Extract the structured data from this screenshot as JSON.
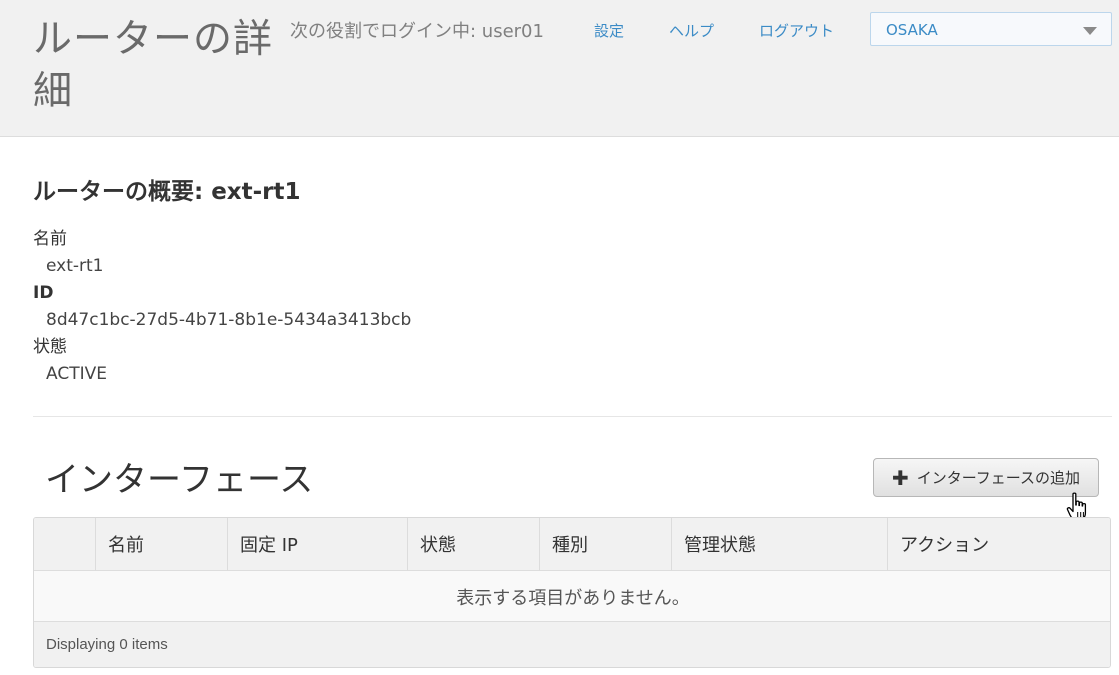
{
  "header": {
    "title": "ルーターの詳細",
    "login_info": "次の役割でログイン中: user01",
    "nav": {
      "settings": "設定",
      "help": "ヘルプ",
      "logout": "ログアウト"
    },
    "region_select": {
      "selected": "OSAKA"
    }
  },
  "overview": {
    "title": "ルーターの概要: ext-rt1",
    "fields": [
      {
        "label": "名前",
        "value": "ext-rt1"
      },
      {
        "label": "ID",
        "value": "8d47c1bc-27d5-4b71-8b1e-5434a3413bcb"
      },
      {
        "label": "状態",
        "value": "ACTIVE"
      }
    ]
  },
  "interfaces": {
    "title": "インターフェース",
    "add_button_label": "インターフェースの追加",
    "table": {
      "columns": [
        "",
        "名前",
        "固定 IP",
        "状態",
        "種別",
        "管理状態",
        "アクション"
      ],
      "empty_message": "表示する項目がありません。",
      "footer": "Displaying 0 items"
    }
  },
  "colors": {
    "link": "#3b8bc6",
    "header_bg": "#f1f1f1"
  }
}
